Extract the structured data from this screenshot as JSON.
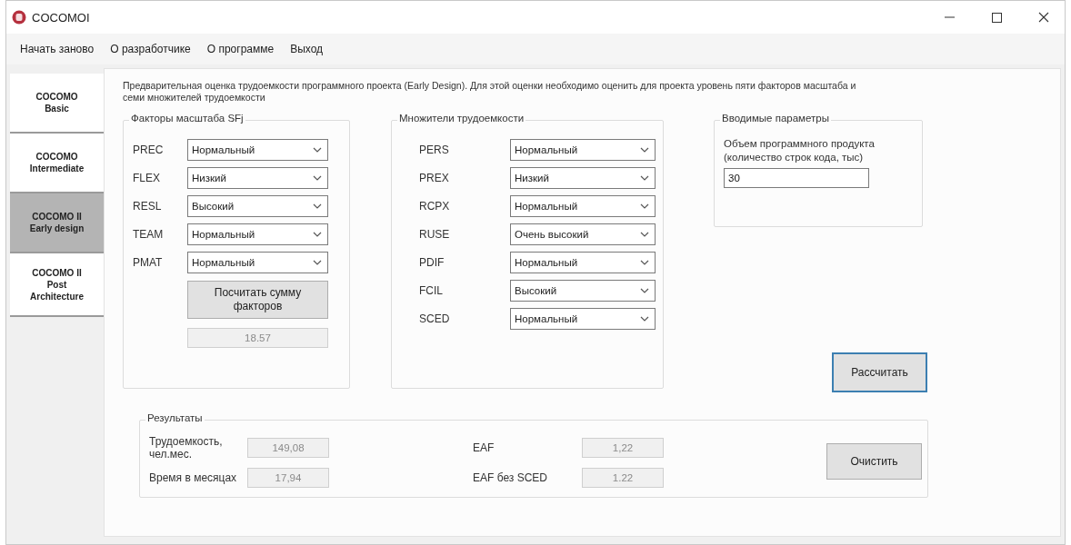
{
  "window": {
    "title": "COCOMOI"
  },
  "menu": [
    {
      "label": "Начать заново"
    },
    {
      "label": "О разработчике"
    },
    {
      "label": "О программе"
    },
    {
      "label": "Выход"
    }
  ],
  "side_tabs": [
    {
      "label": "COCOMO\nBasic",
      "selected": false
    },
    {
      "label": "COCOMO\nIntermediate",
      "selected": false
    },
    {
      "label": "COCOMO II\nEarly design",
      "selected": true
    },
    {
      "label": "COCOMO II\nPost\nArchitecture",
      "selected": false
    }
  ],
  "description": "Предварительная оценка трудоемкости программного проекта (Early Design). Для этой оценки необходимо оценить для проекта уровень пяти факторов масштаба и семи множителей трудоемкости",
  "scale_factors": {
    "title": "Факторы масштаба SFj",
    "rows": [
      {
        "label": "PREC",
        "value": "Нормальный"
      },
      {
        "label": "FLEX",
        "value": "Низкий"
      },
      {
        "label": "RESL",
        "value": "Высокий"
      },
      {
        "label": "TEAM",
        "value": "Нормальный"
      },
      {
        "label": "PMAT",
        "value": "Нормальный"
      }
    ],
    "sum_button": "Посчитать сумму факторов",
    "sum": "18.57"
  },
  "multipliers": {
    "title": "Множители трудоемкости",
    "rows": [
      {
        "label": "PERS",
        "value": "Нормальный"
      },
      {
        "label": "PREX",
        "value": "Низкий"
      },
      {
        "label": "RCPX",
        "value": "Нормальный"
      },
      {
        "label": "RUSE",
        "value": "Очень высокий"
      },
      {
        "label": "PDIF",
        "value": "Нормальный"
      },
      {
        "label": "FCIL",
        "value": "Высокий"
      },
      {
        "label": "SCED",
        "value": "Нормальный"
      }
    ]
  },
  "inputs": {
    "title": "Вводимые параметры",
    "label": "Объем программного продукта (количество строк кода, тыс)",
    "value": "30"
  },
  "calculate_button": "Рассчитать",
  "results": {
    "title": "Результаты",
    "fields": [
      {
        "label": "Трудоемкость, чел.мес.",
        "value": "149,08"
      },
      {
        "label": "EAF",
        "value": "1,22"
      },
      {
        "label": "Время в месяцах",
        "value": "17,94"
      },
      {
        "label": "EAF без SCED",
        "value": "1.22"
      }
    ],
    "clear_button": "Очистить"
  }
}
